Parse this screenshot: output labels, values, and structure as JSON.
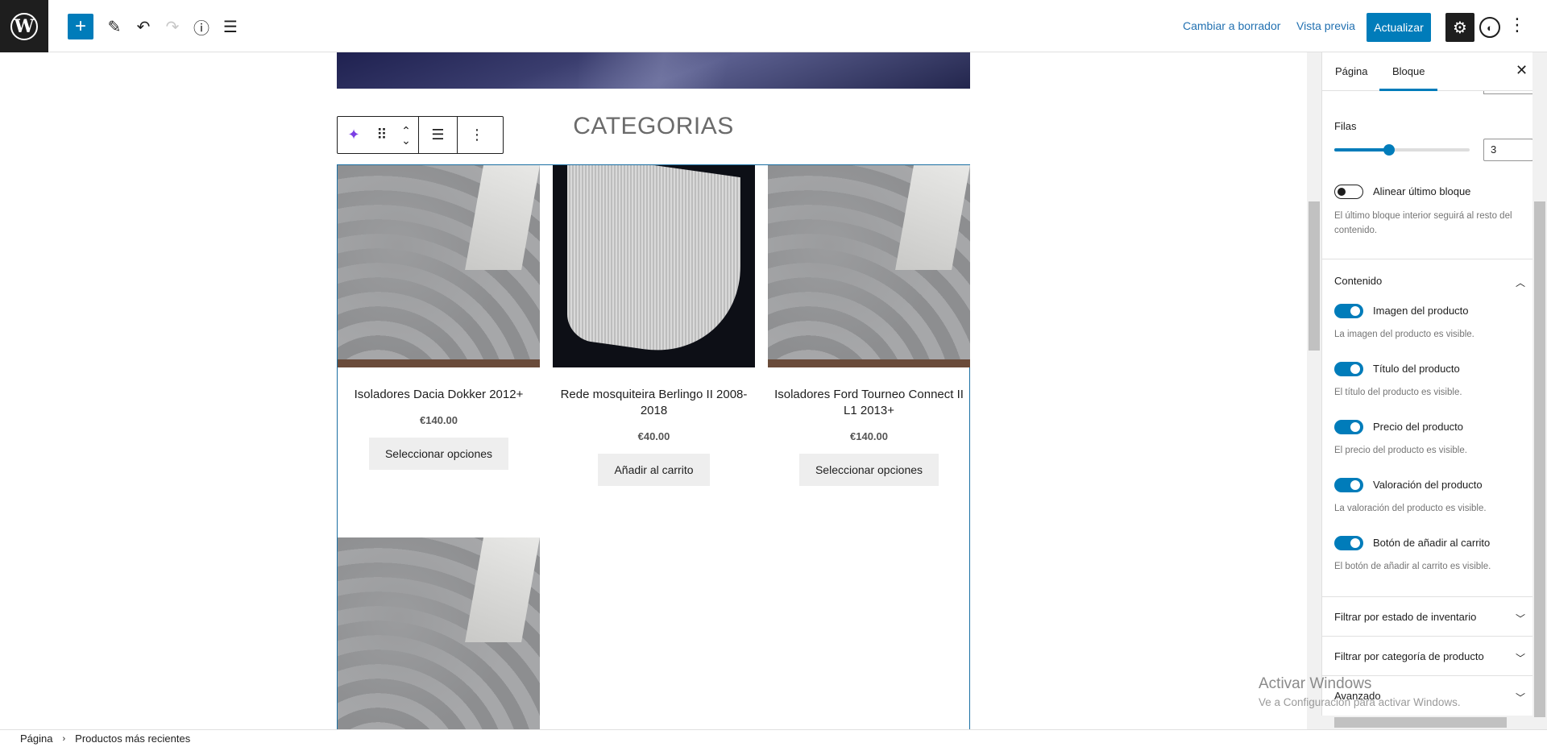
{
  "topbar": {
    "logo_letter": "W",
    "add_icon": "+",
    "edit_icon": "✎",
    "undo_icon": "↶",
    "redo_icon": "↷",
    "info_icon": "ⓘ",
    "list_icon": "☰",
    "switch_draft": "Cambiar a borrador",
    "preview": "Vista previa",
    "update": "Actualizar",
    "settings_icon": "⚙",
    "jetpack_icon": "◐",
    "more_icon": "⋮"
  },
  "canvas": {
    "heading": "CATEGORIAS",
    "block_toolbar": {
      "ai_icon": "✦",
      "drag_icon": "⠿",
      "move_up_icon": "⌃",
      "move_down_icon": "⌄",
      "align_icon": "☰",
      "options_icon": "⋮"
    },
    "products": [
      {
        "title": "Isoladores Dacia Dokker 2012+",
        "price": "€140.00",
        "button": "Seleccionar opciones"
      },
      {
        "title": "Rede mosquiteira Berlingo II 2008-2018",
        "price": "€40.00",
        "button": "Añadir al carrito"
      },
      {
        "title": "Isoladores Ford Tourneo Connect II L1 2013+",
        "price": "€140.00",
        "button": "Seleccionar opciones"
      }
    ]
  },
  "breadcrumb": {
    "root": "Página",
    "current": "Productos más recientes"
  },
  "sidebar": {
    "tabs": [
      "Página",
      "Bloque"
    ],
    "active_tab": "Bloque",
    "close_icon": "✕",
    "rows_label": "Filas",
    "rows_value": "3",
    "align_last_label": "Alinear último bloque",
    "align_last_help": "El último bloque interior seguirá al resto del contenido.",
    "content_panel": "Contenido",
    "toggles": [
      {
        "label": "Imagen del producto",
        "help": "La imagen del producto es visible."
      },
      {
        "label": "Título del producto",
        "help": "El título del producto es visible."
      },
      {
        "label": "Precio del producto",
        "help": "El precio del producto es visible."
      },
      {
        "label": "Valoración del producto",
        "help": "La valoración del producto es visible."
      },
      {
        "label": "Botón de añadir al carrito",
        "help": "El botón de añadir al carrito es visible."
      }
    ],
    "panels": [
      "Filtrar por estado de inventario",
      "Filtrar por categoría de producto",
      "Avanzado"
    ]
  },
  "watermark": {
    "title": "Activar Windows",
    "subtitle": "Ve a Configuración para activar Windows."
  },
  "colors": {
    "accent": "#007cba",
    "selection": "#1a6fa3",
    "dark": "#1e1e1e"
  }
}
